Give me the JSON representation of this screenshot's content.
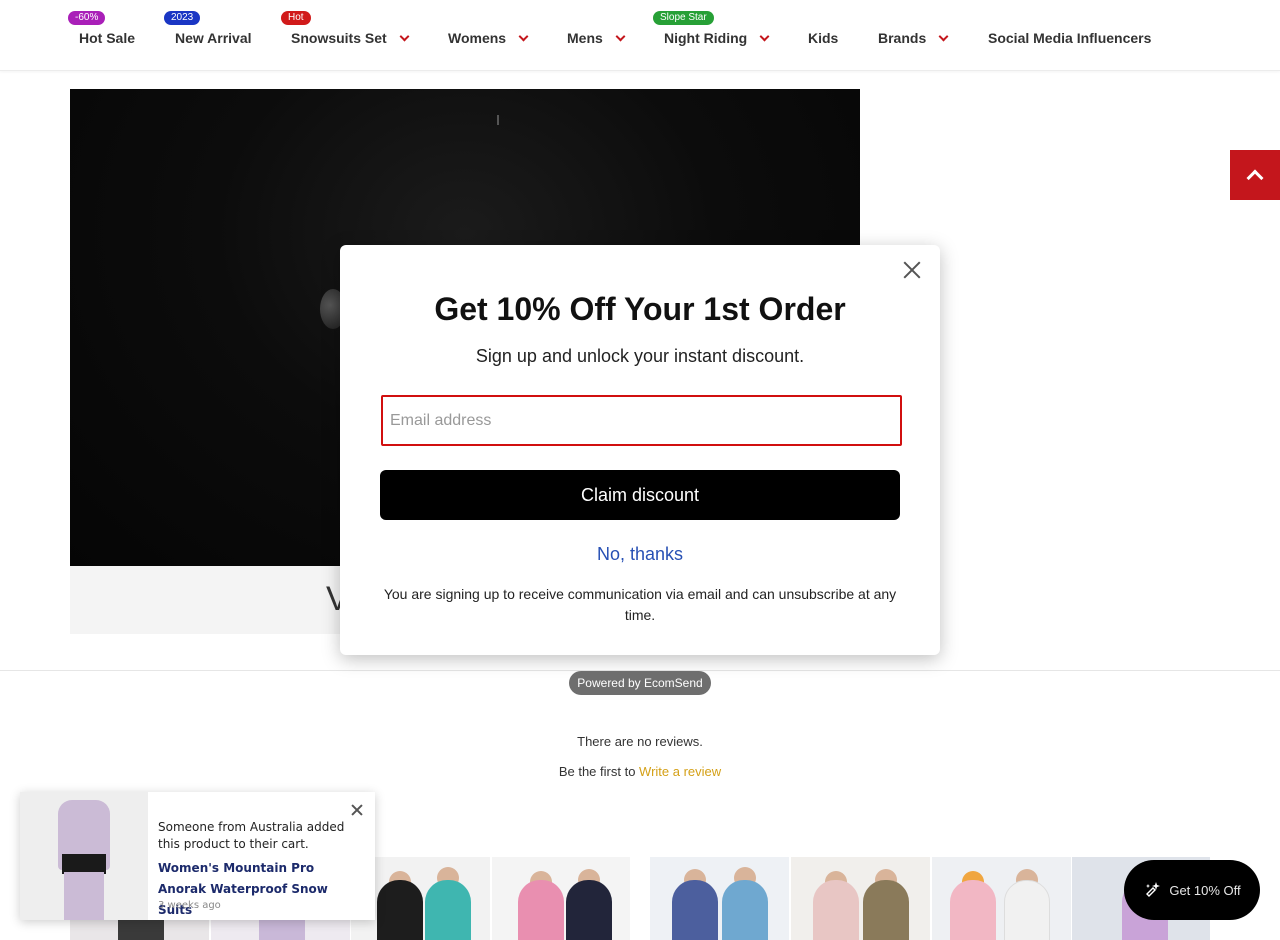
{
  "nav": {
    "items": [
      {
        "label": "Hot Sale",
        "badge": "-60%",
        "badge_color": "#a91fb8",
        "has_dropdown": false
      },
      {
        "label": "New Arrival",
        "badge": "2023",
        "badge_color": "#1a36c4",
        "has_dropdown": false
      },
      {
        "label": "Snowsuits Set",
        "badge": "Hot",
        "badge_color": "#d11a1a",
        "has_dropdown": true
      },
      {
        "label": "Womens",
        "badge": "",
        "has_dropdown": true
      },
      {
        "label": "Mens",
        "badge": "",
        "has_dropdown": true
      },
      {
        "label": "Night Riding",
        "badge": "Slope Star",
        "badge_color": "#27a036",
        "has_dropdown": true
      },
      {
        "label": "Kids",
        "badge": "",
        "has_dropdown": false
      },
      {
        "label": "Brands",
        "badge": "",
        "has_dropdown": true
      },
      {
        "label": "Social Media Influencers",
        "badge": "",
        "has_dropdown": false
      }
    ]
  },
  "hero": {
    "caption_letter": "V"
  },
  "modal": {
    "title": "Get 10% Off Your 1st Order",
    "subtitle": "Sign up and unlock your instant discount.",
    "email_placeholder": "Email address",
    "email_value": "",
    "claim_label": "Claim discount",
    "decline_label": "No, thanks",
    "disclaimer": "You are signing up to receive communication via email and can unsubscribe at any time.",
    "powered_by": "Powered by EcomSend"
  },
  "reviews": {
    "empty_text": "There are no reviews.",
    "prompt_prefix": "Be the first to",
    "write_link": "Write a review"
  },
  "toast": {
    "message": "Someone from Australia added this product to their cart.",
    "product": "Women's Mountain Pro Anorak Waterproof Snow Suits",
    "time": "3 weeks ago"
  },
  "fab": {
    "label": "Get 10% Off"
  },
  "colors": {
    "accent": "#c4161c",
    "link_blue": "#2750b4",
    "review_link": "#d4a017",
    "input_border": "#d10f0f"
  }
}
